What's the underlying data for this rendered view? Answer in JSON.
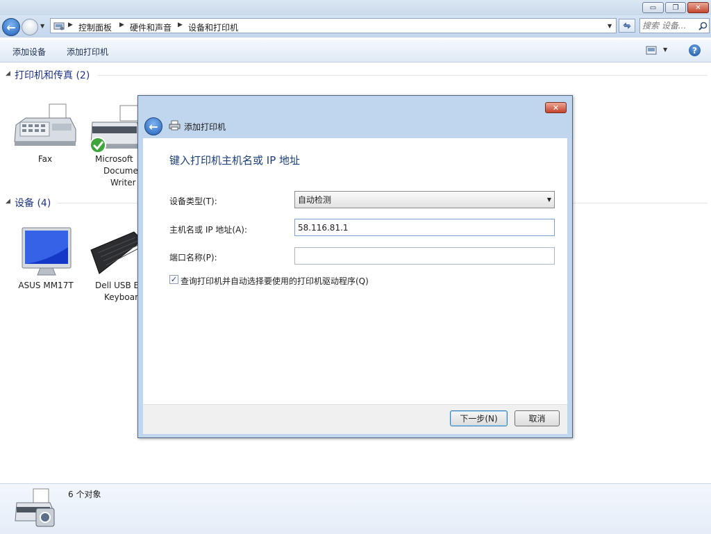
{
  "window": {
    "caption_buttons": {
      "minimize": "▭",
      "maximize": "❐",
      "close": "✕"
    }
  },
  "address": {
    "breadcrumbs": [
      "控制面板",
      "硬件和声音",
      "设备和打印机"
    ],
    "refresh_icon": "refresh-icon"
  },
  "search": {
    "placeholder": "搜索 设备..."
  },
  "toolbar": {
    "add_device": "添加设备",
    "add_printer": "添加打印机"
  },
  "groups": {
    "printers": {
      "title": "打印机和传真 (2)",
      "items": [
        {
          "label": "Fax"
        },
        {
          "label_lines": [
            "Microsoft",
            "Docume",
            "Writer"
          ]
        }
      ]
    },
    "devices": {
      "title": "设备 (4)",
      "items": [
        {
          "label": "ASUS MM17T"
        },
        {
          "label_lines": [
            "Dell USB E",
            "Keyboar"
          ]
        }
      ]
    }
  },
  "status": {
    "count_text": "6 个对象"
  },
  "dialog": {
    "title": "添加打印机",
    "close": "✕",
    "heading": "键入打印机主机名或 IP 地址",
    "fields": {
      "device_type_label": "设备类型(T):",
      "device_type_value": "自动检测",
      "hostname_label": "主机名或 IP 地址(A):",
      "hostname_value": "58.116.81.1",
      "port_label": "端口名称(P):",
      "port_value": ""
    },
    "query_driver": {
      "checked": true,
      "label": "查询打印机并自动选择要使用的打印机驱动程序(Q)"
    },
    "buttons": {
      "next": "下一步(N)",
      "cancel": "取消"
    }
  },
  "colors": {
    "accent": "#1f5fb8",
    "group_header": "#1e3287",
    "dialog_heading": "#1a3e7c",
    "dialog_frame": "#c0d6ee"
  }
}
